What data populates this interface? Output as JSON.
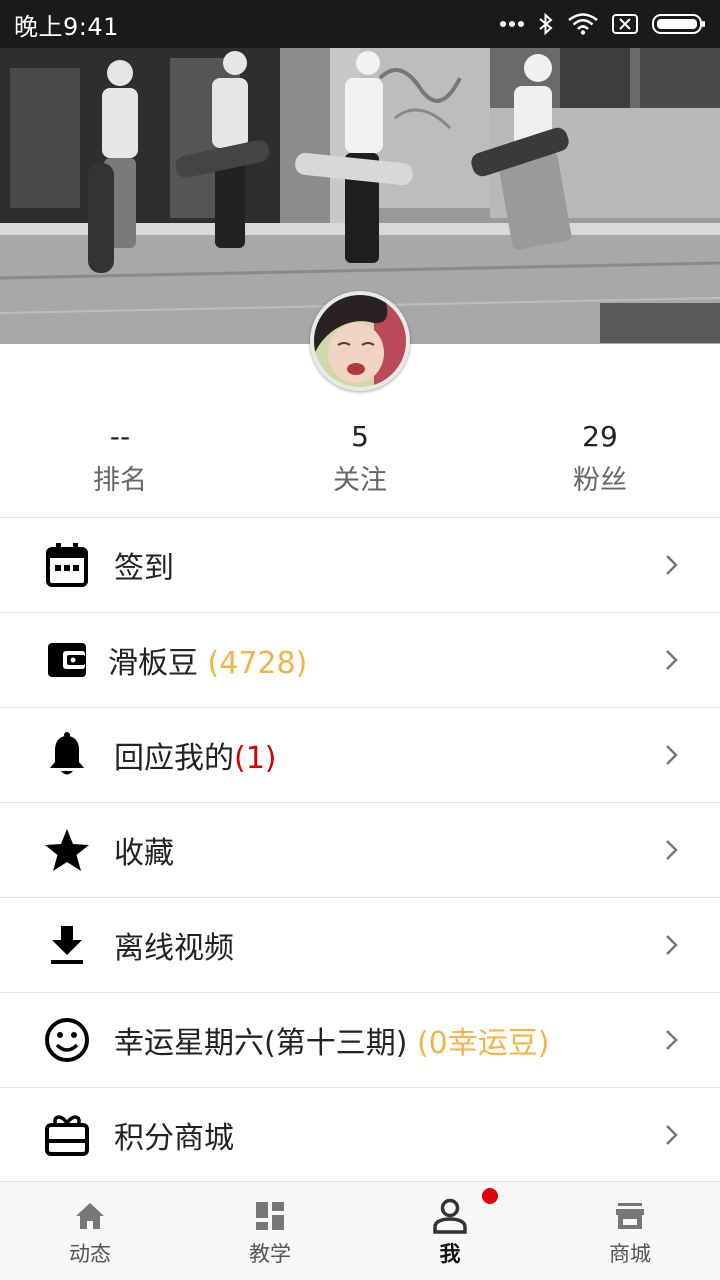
{
  "status_bar": {
    "time": "晚上9:41"
  },
  "stats": [
    {
      "value": "--",
      "label": "排名"
    },
    {
      "value": "5",
      "label": "关注"
    },
    {
      "value": "29",
      "label": "粉丝"
    }
  ],
  "menu": [
    {
      "icon": "calendar-icon",
      "label": "签到",
      "extra": ""
    },
    {
      "icon": "wallet-icon",
      "label": "滑板豆 ",
      "extra": "(4728)"
    },
    {
      "icon": "bell-icon",
      "label": "回应我的",
      "extra": "(1)"
    },
    {
      "icon": "star-icon",
      "label": "收藏",
      "extra": ""
    },
    {
      "icon": "download-icon",
      "label": "离线视频",
      "extra": ""
    },
    {
      "icon": "smiley-icon",
      "label": "幸运星期六(第十三期) ",
      "extra": "(0幸运豆)"
    },
    {
      "icon": "gift-icon",
      "label": "积分商城",
      "extra": ""
    }
  ],
  "bottom_nav": [
    {
      "icon": "home-icon",
      "label": "动态",
      "active": false
    },
    {
      "icon": "dashboard-icon",
      "label": "教学",
      "active": false
    },
    {
      "icon": "person-icon",
      "label": "我",
      "active": true
    },
    {
      "icon": "store-icon",
      "label": "商城",
      "active": false
    }
  ],
  "colors": {
    "accent_orange": "#f0b54a",
    "badge_red": "#d40000",
    "notification_dot": "#e0000a",
    "status_bar": "#1a1a1a"
  }
}
